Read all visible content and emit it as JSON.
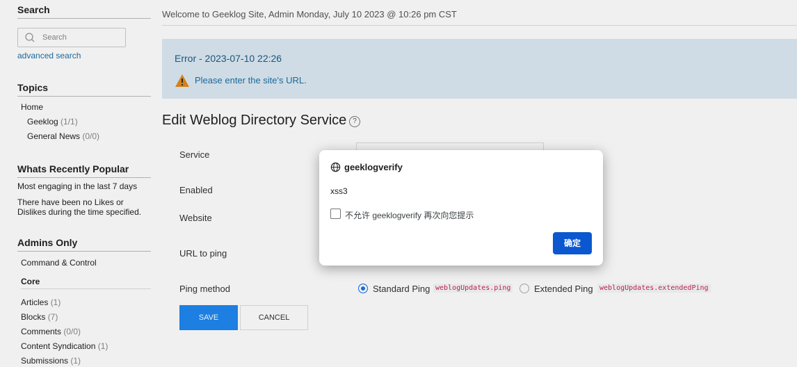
{
  "sidebar": {
    "search_heading": "Search",
    "search_placeholder": "Search",
    "advanced_search": "advanced search",
    "topics_heading": "Topics",
    "topics": [
      {
        "label": "Home",
        "count": ""
      },
      {
        "label": "Geeklog",
        "count": "(1/1)"
      },
      {
        "label": "General News",
        "count": "(0/0)"
      }
    ],
    "popular_heading": "Whats Recently Popular",
    "popular_period": "Most engaging in the last 7 days",
    "popular_empty": "There have been no Likes or Dislikes during the time specified.",
    "admins_heading": "Admins Only",
    "command_control": "Command & Control",
    "core": "Core",
    "admin_items": [
      {
        "label": "Articles",
        "count": "(1)"
      },
      {
        "label": "Blocks",
        "count": "(7)"
      },
      {
        "label": "Comments",
        "count": "(0/0)"
      },
      {
        "label": "Content Syndication",
        "count": "(1)"
      },
      {
        "label": "Submissions",
        "count": "(1)"
      }
    ]
  },
  "main": {
    "welcome": "Welcome to Geeklog Site, Admin Monday, July 10 2023 @ 10:26 pm CST",
    "alert_title": "Error - 2023-07-10 22:26",
    "alert_message": "Please enter the site's URL.",
    "page_title": "Edit Weblog Directory Service",
    "help": "?",
    "form": {
      "service_label": "Service",
      "enabled_label": "Enabled",
      "website_label": "Website",
      "url_label": "URL to ping",
      "ping_method_label": "Ping method",
      "standard_ping": "Standard Ping",
      "standard_code": "weblogUpdates.ping",
      "extended_ping": "Extended Ping",
      "extended_code": "weblogUpdates.extendedPing",
      "save": "SAVE",
      "cancel": "CANCEL"
    }
  },
  "dialog": {
    "title": "geeklogverify",
    "message": "xss3",
    "checkbox_label": "不允许 geeklogverify 再次向您提示",
    "ok": "确定"
  }
}
